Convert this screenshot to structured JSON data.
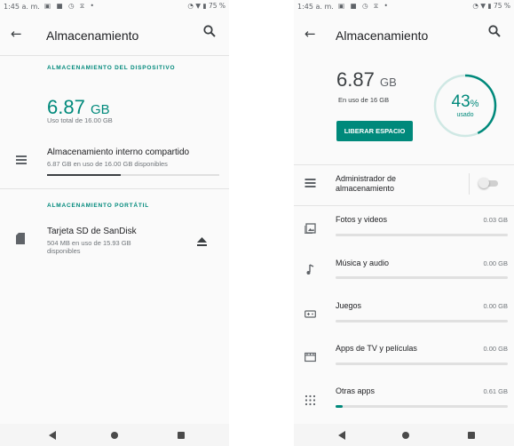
{
  "colors": {
    "accent": "#00897b",
    "text_primary": "#202124",
    "text_secondary": "#70757a",
    "bar_track": "#e0e0e0"
  },
  "statusbar": {
    "time": "1:45 a. m.",
    "battery": "75 %"
  },
  "left_screen": {
    "title": "Almacenamiento",
    "device_section_label": "ALMACENAMIENTO DEL DISPOSITIVO",
    "used_value": "6.87",
    "used_unit": "GB",
    "used_total_text": "Uso total de 16.00 GB",
    "internal_storage": {
      "title": "Almacenamiento interno compartido",
      "subtitle": "6.87 GB en uso de 16.00 GB disponibles",
      "usage_fraction": 0.43
    },
    "portable_section_label": "ALMACENAMIENTO PORTÁTIL",
    "sd_card": {
      "title": "Tarjeta SD de SanDisk",
      "subtitle_line1": "504 MB en uso de 15.93 GB",
      "subtitle_line2": "disponibles"
    }
  },
  "right_screen": {
    "title": "Almacenamiento",
    "used_value": "6.87",
    "used_unit": "GB",
    "used_of_text": "En uso de 16 GB",
    "free_space_button": "LIBERAR ESPACIO",
    "percent_value": "43",
    "percent_symbol": "%",
    "percent_label": "usado",
    "percent_used": 43,
    "storage_manager": {
      "line1": "Administrador de",
      "line2": "almacenamiento",
      "enabled": false
    },
    "categories": [
      {
        "label": "Fotos y videos",
        "value": "0.03 GB",
        "icon": "photo-icon",
        "usage_fraction": 0.0
      },
      {
        "label": "Música y audio",
        "value": "0.00 GB",
        "icon": "music-note-icon",
        "usage_fraction": 0.0
      },
      {
        "label": "Juegos",
        "value": "0.00 GB",
        "icon": "gamepad-icon",
        "usage_fraction": 0.0
      },
      {
        "label": "Apps de TV y películas",
        "value": "0.00 GB",
        "icon": "movie-icon",
        "usage_fraction": 0.0
      },
      {
        "label": "Otras apps",
        "value": "0.61 GB",
        "icon": "apps-grid-icon",
        "usage_fraction": 0.04
      }
    ]
  }
}
